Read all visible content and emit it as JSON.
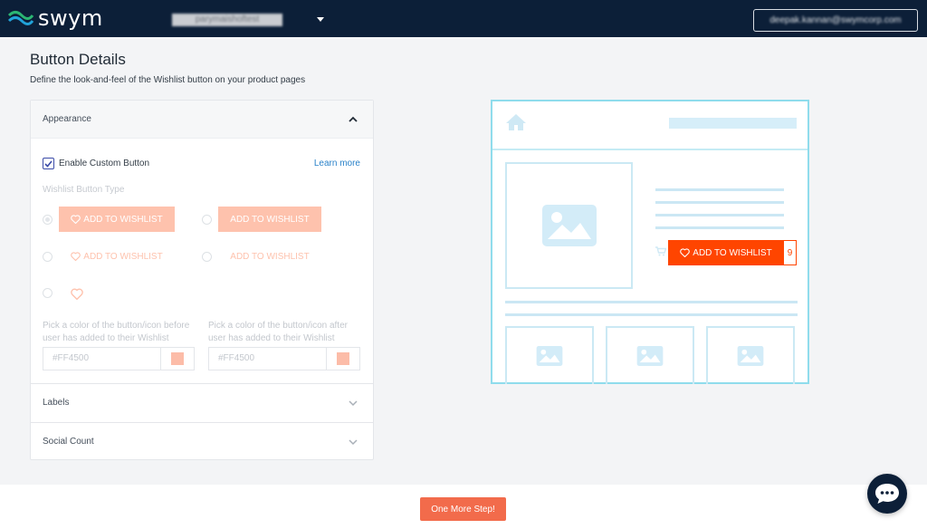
{
  "header": {
    "logo_text": "swym",
    "store_name": "parymaishoftest",
    "user_email": "deepak.kannan@swymcorp.com"
  },
  "page": {
    "title": "Button Details",
    "subtitle": "Define the look-and-feel of the Wishlist button on your product pages"
  },
  "appearance": {
    "section_title": "Appearance",
    "expanded": true,
    "enable_custom_button_label": "Enable Custom Button",
    "enable_custom_button_checked": true,
    "learn_more_label": "Learn more",
    "button_type_label": "Wishlist Button Type",
    "button_options": [
      {
        "label": "ADD TO WISHLIST",
        "style": "filled-with-icon",
        "selected": true
      },
      {
        "label": "ADD TO WISHLIST",
        "style": "filled",
        "selected": false
      },
      {
        "label": "ADD TO WISHLIST",
        "style": "text-with-icon",
        "selected": false
      },
      {
        "label": "ADD TO WISHLIST",
        "style": "text",
        "selected": false
      },
      {
        "label": "",
        "style": "icon-only",
        "selected": false
      }
    ],
    "color_before_label": "Pick a color of the button/icon before user has added to their Wishlist",
    "color_before_value": "#FF4500",
    "color_after_label": "Pick a color of the button/icon after user has added to their Wishlist",
    "color_after_value": "#FF4500"
  },
  "sections": {
    "labels_title": "Labels",
    "social_count_title": "Social Count"
  },
  "preview": {
    "wishlist_button_label": "ADD TO WISHLIST",
    "wishlist_count": "9"
  },
  "footer": {
    "next_button_label": "One More Step!"
  },
  "colors": {
    "topbar": "#0c1f38",
    "accent": "#ff4500",
    "next_button": "#f26b4b",
    "preview_border": "#8fdcec"
  }
}
